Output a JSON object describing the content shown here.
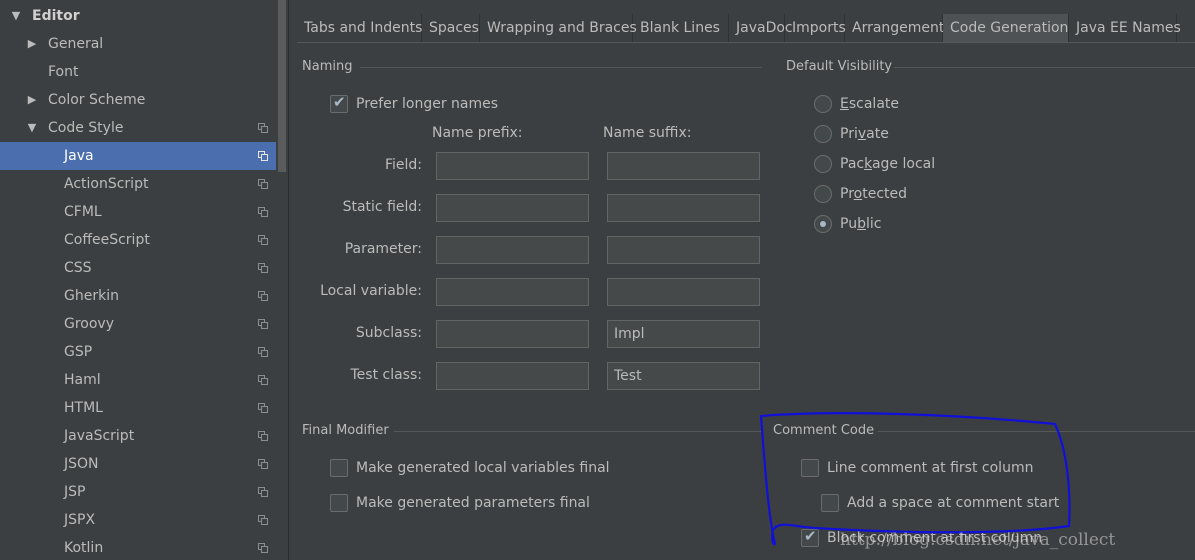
{
  "sidebar": {
    "items": [
      {
        "label": "Editor",
        "arrow": "▼",
        "bold": true,
        "copy": false,
        "selected": false
      },
      {
        "label": "General",
        "arrow": "▶",
        "bold": false,
        "copy": false,
        "selected": false
      },
      {
        "label": "Font",
        "arrow": "",
        "bold": false,
        "copy": false,
        "selected": false
      },
      {
        "label": "Color Scheme",
        "arrow": "▶",
        "bold": false,
        "copy": false,
        "selected": false
      },
      {
        "label": "Code Style",
        "arrow": "▼",
        "bold": false,
        "copy": true,
        "selected": false
      },
      {
        "label": "Java",
        "arrow": "",
        "bold": false,
        "copy": true,
        "selected": true
      },
      {
        "label": "ActionScript",
        "arrow": "",
        "bold": false,
        "copy": true,
        "selected": false
      },
      {
        "label": "CFML",
        "arrow": "",
        "bold": false,
        "copy": true,
        "selected": false
      },
      {
        "label": "CoffeeScript",
        "arrow": "",
        "bold": false,
        "copy": true,
        "selected": false
      },
      {
        "label": "CSS",
        "arrow": "",
        "bold": false,
        "copy": true,
        "selected": false
      },
      {
        "label": "Gherkin",
        "arrow": "",
        "bold": false,
        "copy": true,
        "selected": false
      },
      {
        "label": "Groovy",
        "arrow": "",
        "bold": false,
        "copy": true,
        "selected": false
      },
      {
        "label": "GSP",
        "arrow": "",
        "bold": false,
        "copy": true,
        "selected": false
      },
      {
        "label": "Haml",
        "arrow": "",
        "bold": false,
        "copy": true,
        "selected": false
      },
      {
        "label": "HTML",
        "arrow": "",
        "bold": false,
        "copy": true,
        "selected": false
      },
      {
        "label": "JavaScript",
        "arrow": "",
        "bold": false,
        "copy": true,
        "selected": false
      },
      {
        "label": "JSON",
        "arrow": "",
        "bold": false,
        "copy": true,
        "selected": false
      },
      {
        "label": "JSP",
        "arrow": "",
        "bold": false,
        "copy": true,
        "selected": false
      },
      {
        "label": "JSPX",
        "arrow": "",
        "bold": false,
        "copy": true,
        "selected": false
      },
      {
        "label": "Kotlin",
        "arrow": "",
        "bold": false,
        "copy": true,
        "selected": false
      }
    ]
  },
  "tabs": [
    {
      "label": "Tabs and Indents",
      "active": false
    },
    {
      "label": "Spaces",
      "active": false
    },
    {
      "label": "Wrapping and Braces",
      "active": false
    },
    {
      "label": "Blank Lines",
      "active": false
    },
    {
      "label": "JavaDoc",
      "active": false
    },
    {
      "label": "Imports",
      "active": false
    },
    {
      "label": "Arrangement",
      "active": false
    },
    {
      "label": "Code Generation",
      "active": true
    },
    {
      "label": "Java EE Names",
      "active": false
    }
  ],
  "naming": {
    "title": "Naming",
    "prefer_longer": {
      "label": "Prefer longer names",
      "checked": true
    },
    "prefix_header": "Name prefix:",
    "suffix_header": "Name suffix:",
    "rows": [
      {
        "label": "Field:",
        "prefix": "",
        "suffix": ""
      },
      {
        "label": "Static field:",
        "prefix": "",
        "suffix": ""
      },
      {
        "label": "Parameter:",
        "prefix": "",
        "suffix": ""
      },
      {
        "label": "Local variable:",
        "prefix": "",
        "suffix": ""
      },
      {
        "label": "Subclass:",
        "prefix": "",
        "suffix": "Impl"
      },
      {
        "label": "Test class:",
        "prefix": "",
        "suffix": "Test"
      }
    ]
  },
  "visibility": {
    "title": "Default Visibility",
    "options": [
      {
        "pre": "",
        "ul": "E",
        "post": "scalate",
        "selected": false
      },
      {
        "pre": "Pri",
        "ul": "v",
        "post": "ate",
        "selected": false
      },
      {
        "pre": "Pac",
        "ul": "k",
        "post": "age local",
        "selected": false
      },
      {
        "pre": "Pr",
        "ul": "o",
        "post": "tected",
        "selected": false
      },
      {
        "pre": "Pu",
        "ul": "b",
        "post": "lic",
        "selected": true
      }
    ]
  },
  "final_modifier": {
    "title": "Final Modifier",
    "options": [
      {
        "label": "Make generated local variables final",
        "checked": false
      },
      {
        "label": "Make generated parameters final",
        "checked": false
      }
    ]
  },
  "comment_code": {
    "title": "Comment Code",
    "options": [
      {
        "label": "Line comment at first column",
        "checked": false
      },
      {
        "label": "Add a space at comment start",
        "checked": false
      },
      {
        "label": "Block comment at first column",
        "checked": true
      }
    ]
  },
  "watermark": "http://blog.csdn.net/java_collect",
  "colors": {
    "selection": "#4b6eaf",
    "annotation_ink": "#1010d8"
  }
}
